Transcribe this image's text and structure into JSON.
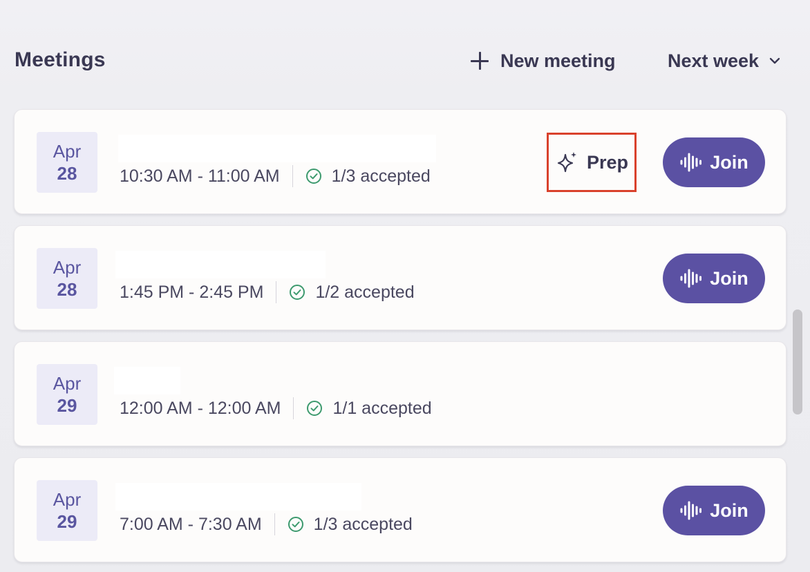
{
  "header": {
    "title": "Meetings",
    "new_meeting_label": "New meeting",
    "period_label": "Next week"
  },
  "meetings": [
    {
      "month": "Apr",
      "day": "28",
      "time": "10:30 AM - 11:00 AM",
      "accepted": "1/3 accepted",
      "prep_label": "Prep",
      "join_label": "Join"
    },
    {
      "month": "Apr",
      "day": "28",
      "time": "1:45 PM - 2:45 PM",
      "accepted": "1/2 accepted",
      "join_label": "Join"
    },
    {
      "month": "Apr",
      "day": "29",
      "time": "12:00 AM - 12:00 AM",
      "accepted": "1/1 accepted"
    },
    {
      "month": "Apr",
      "day": "29",
      "time": "7:00 AM - 7:30 AM",
      "accepted": "1/3 accepted",
      "join_label": "Join"
    }
  ],
  "colors": {
    "accent": "#5b51a3",
    "accepted_check": "#3d9a6e",
    "highlight_box": "#d9412c"
  },
  "icons": {
    "new_meeting": "plus-icon",
    "period": "chevron-down-icon",
    "accepted": "check-circle-icon",
    "join": "soundwave-icon",
    "prep": "sparkle-icon"
  }
}
